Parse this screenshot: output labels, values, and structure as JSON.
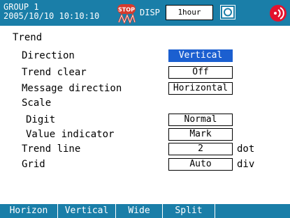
{
  "header": {
    "group": "GROUP 1",
    "datetime": "2005/10/10 10:10:10",
    "disp_label": "DISP",
    "time_value": "1hour",
    "colors": {
      "bar": "#1a7ea8",
      "selected": "#1b5fd0",
      "stop_icon": "#d63a2c",
      "alarm": "#e3122d"
    }
  },
  "page": {
    "title": "Trend",
    "rows": [
      {
        "label": "Direction",
        "value": "Vertical",
        "selected": true,
        "unit": ""
      },
      {
        "label": "Trend clear",
        "value": "Off",
        "selected": false,
        "unit": ""
      },
      {
        "label": "Message direction",
        "value": "Horizontal",
        "selected": false,
        "unit": ""
      },
      {
        "label": "Scale",
        "value": "",
        "selected": false,
        "unit": ""
      },
      {
        "label": "Digit",
        "value": "Normal",
        "selected": false,
        "unit": ""
      },
      {
        "label": "Value indicator",
        "value": "Mark",
        "selected": false,
        "unit": ""
      },
      {
        "label": "Trend line",
        "value": "2",
        "selected": false,
        "unit": "dot"
      },
      {
        "label": "Grid",
        "value": "Auto",
        "selected": false,
        "unit": "div"
      }
    ]
  },
  "softkeys": [
    "Horizon",
    "Vertical",
    "Wide",
    "Split"
  ],
  "icons": {
    "stop": "stop-recording-icon",
    "target": "display-target-icon",
    "alarm": "alarm-icon"
  }
}
